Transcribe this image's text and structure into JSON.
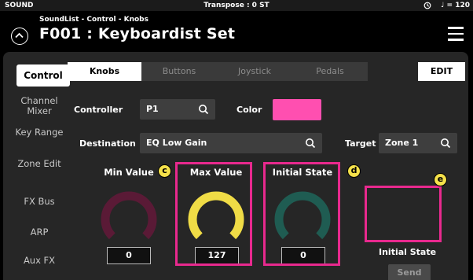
{
  "status_bar": {
    "mode": "SOUND",
    "transpose": "Transpose : 0 ST",
    "tempo": "♩ = 120"
  },
  "header": {
    "breadcrumb": "SoundList - Control - Knobs",
    "title": "F001 : Keyboardist Set"
  },
  "sidebar": {
    "items": [
      {
        "label": "Control"
      },
      {
        "label": "Channel Mixer"
      },
      {
        "label": "Key Range"
      },
      {
        "label": "Zone Edit"
      },
      {
        "label": "FX Bus"
      },
      {
        "label": "ARP"
      },
      {
        "label": "Aux FX"
      }
    ]
  },
  "tabs": [
    {
      "label": "Knobs"
    },
    {
      "label": "Buttons"
    },
    {
      "label": "Joystick"
    },
    {
      "label": "Pedals"
    }
  ],
  "edit_label": "EDIT",
  "form": {
    "controller_label": "Controller",
    "controller_value": "P1",
    "color_label": "Color",
    "color_value": "#ff4fb0",
    "destination_label": "Destination",
    "destination_value": "EQ Low Gain",
    "target_label": "Target",
    "target_value": "Zone 1"
  },
  "knobs": [
    {
      "label": "Min Value",
      "value": "0",
      "color": "#5a1a36",
      "fraction": 0.0
    },
    {
      "label": "Max Value",
      "value": "127",
      "color": "#f0dc46",
      "fraction": 1.0
    },
    {
      "label": "Initial State",
      "value": "0",
      "color": "#1f5c52",
      "fraction": 0.0
    }
  ],
  "send_panel": {
    "label": "Initial State",
    "button": "Send"
  },
  "callouts": {
    "c": "c",
    "d": "d",
    "e": "e"
  },
  "colors": {
    "highlight": "#e8298e",
    "callout": "#f5e14a",
    "active_tab": "#ffffff"
  }
}
